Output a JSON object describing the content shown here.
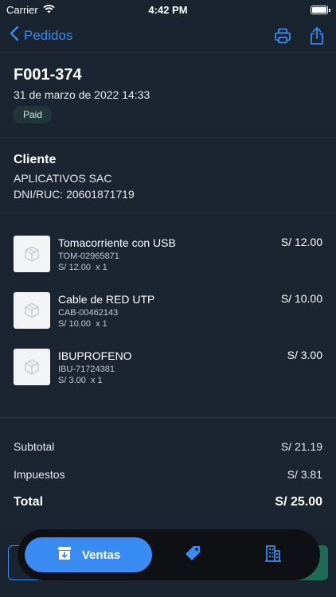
{
  "status_bar": {
    "carrier": "Carrier",
    "time": "4:42 PM"
  },
  "nav": {
    "back_label": "Pedidos"
  },
  "order": {
    "number": "F001-374",
    "date": "31 de marzo de 2022 14:33",
    "status": "Paid"
  },
  "client": {
    "title": "Cliente",
    "name": "APLICATIVOS SAC",
    "document": "DNI/RUC: 20601871719"
  },
  "items": [
    {
      "name": "Tomacorriente con USB",
      "sku": "TOM-02965871",
      "unit": "S/ 12.00",
      "qty": "x 1",
      "price": "S/ 12.00"
    },
    {
      "name": "Cable de RED UTP",
      "sku": "CAB-00462143",
      "unit": "S/ 10.00",
      "qty": "x 1",
      "price": "S/ 10.00"
    },
    {
      "name": "IBUPROFENO",
      "sku": "IBU-71724381",
      "unit": "S/ 3.00",
      "qty": "x 1",
      "price": "S/ 3.00"
    }
  ],
  "totals": {
    "subtotal_label": "Subtotal",
    "subtotal": "S/ 21.19",
    "taxes_label": "Impuestos",
    "taxes": "S/ 3.81",
    "total_label": "Total",
    "total": "S/ 25.00"
  },
  "tab_bar": {
    "active_label": "Ventas"
  },
  "colors": {
    "accent": "#3b8cf2",
    "background": "#1a2330",
    "badge_bg": "#22363a",
    "confirm_green": "#1e6b55"
  },
  "icons": [
    "wifi-icon",
    "battery-icon",
    "chevron-left-icon",
    "printer-icon",
    "share-icon",
    "box-icon",
    "archive-icon",
    "tag-icon",
    "building-icon"
  ]
}
